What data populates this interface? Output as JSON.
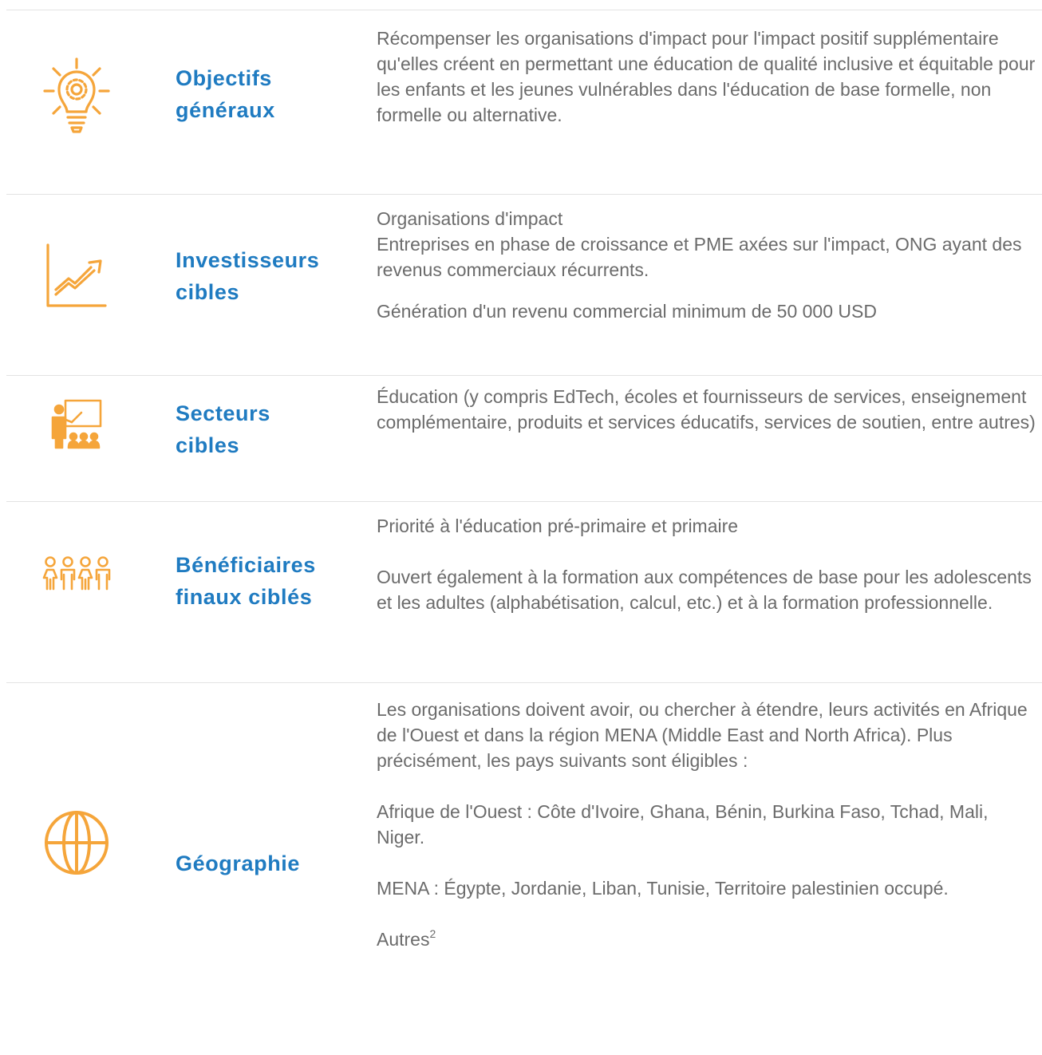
{
  "colors": {
    "accent_orange": "#f5a53a",
    "label_blue": "#1f7bc1",
    "body_grey": "#6b6b6b",
    "rule_grey": "#e3e3e3"
  },
  "rows": [
    {
      "icon": "lightbulb-gear-icon",
      "label_line1": "Objectifs",
      "label_line2": "généraux",
      "paragraphs": [
        "Récompenser les organisations d'impact pour l'impact positif supplémentaire qu'elles créent en permettant une éducation de qualité inclusive et équitable pour les enfants et les jeunes vulnérables dans l'éducation de base formelle, non formelle ou alternative."
      ]
    },
    {
      "icon": "growth-chart-icon",
      "label_line1": "Investisseurs",
      "label_line2": "cibles",
      "paragraphs": [
        "Organisations d'impact",
        "Entreprises en phase de croissance et PME axées sur l'impact, ONG ayant des revenus commerciaux récurrents.",
        "Génération d'un revenu commercial minimum de 50 000 USD"
      ]
    },
    {
      "icon": "teacher-classroom-icon",
      "label_line1": "Secteurs",
      "label_line2": "cibles",
      "paragraphs": [
        "Éducation (y compris EdTech, écoles et fournisseurs de services, enseignement complémentaire, produits et services éducatifs, services de soutien, entre autres)"
      ]
    },
    {
      "icon": "people-group-icon",
      "label_line1": "Bénéficiaires",
      "label_line2": "finaux ciblés",
      "paragraphs": [
        "Priorité à l'éducation pré-primaire et primaire",
        "Ouvert également à la formation aux compétences de base pour les adolescents et les adultes (alphabétisation, calcul, etc.) et à la formation professionnelle."
      ]
    },
    {
      "icon": "globe-icon",
      "label_line1": "Géographie",
      "label_line2": "",
      "paragraphs": [
        "Les organisations doivent avoir, ou chercher à étendre, leurs activités en Afrique de l'Ouest et dans la région MENA (Middle East and North Africa). Plus précisément, les pays suivants sont éligibles :",
        "Afrique de l'Ouest : Côte d'Ivoire, Ghana, Bénin, Burkina Faso, Tchad, Mali, Niger.",
        "MENA : Égypte, Jordanie, Liban, Tunisie, Territoire palestinien occupé."
      ],
      "last_paragraph_text": "Autres",
      "last_paragraph_sup": "2"
    }
  ]
}
